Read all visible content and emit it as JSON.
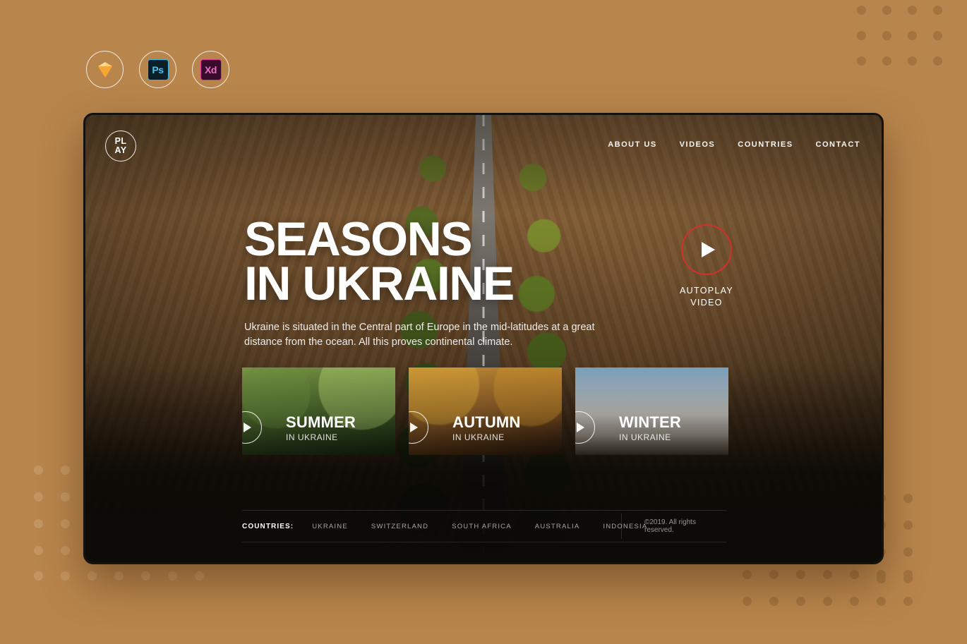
{
  "background": {
    "color": "#b8854c",
    "dot_dark": "#a3743f",
    "dot_light": "#c29561"
  },
  "app_icons": [
    {
      "name": "sketch",
      "label": ""
    },
    {
      "name": "photoshop",
      "label": "Ps"
    },
    {
      "name": "xd",
      "label": "Xd"
    }
  ],
  "site": {
    "logo": {
      "line1": "PL",
      "line2": "AY"
    },
    "nav": [
      {
        "label": "ABOUT US"
      },
      {
        "label": "VIDEOS"
      },
      {
        "label": "COUNTRIES"
      },
      {
        "label": "CONTACT"
      }
    ],
    "hero": {
      "title_line1": "SEASONS",
      "title_line2": "IN UKRAINE",
      "subtitle": "Ukraine is situated in the Central part of Europe in the mid-latitudes at a great distance from the ocean. All this proves continental climate.",
      "autoplay": {
        "label_line1": "AUTOPLAY",
        "label_line2": "VIDEO",
        "ring_color": "#d2302c"
      }
    },
    "cards": [
      {
        "title": "SUMMER",
        "subtitle": "IN UKRAINE"
      },
      {
        "title": "AUTUMN",
        "subtitle": "IN UKRAINE"
      },
      {
        "title": "WINTER",
        "subtitle": "IN UKRAINE"
      }
    ],
    "footer": {
      "label": "COUNTRIES:",
      "countries": [
        {
          "label": "UKRAINE"
        },
        {
          "label": "SWITZERLAND"
        },
        {
          "label": "SOUTH AFRICA"
        },
        {
          "label": "AUSTRALIA"
        },
        {
          "label": "INDONESIA"
        }
      ],
      "copyright": "©2019. All rights reserved."
    }
  }
}
